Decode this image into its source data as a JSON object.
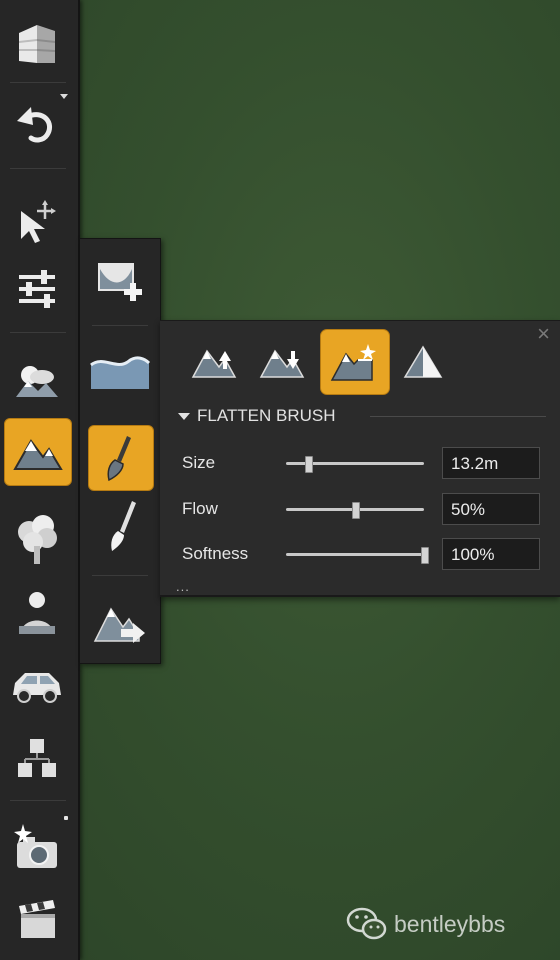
{
  "toolbar": {
    "items": [
      {
        "name": "building-icon"
      },
      {
        "name": "undo-icon"
      },
      {
        "name": "select-move-icon"
      },
      {
        "name": "sliders-icon"
      },
      {
        "name": "sky-icon"
      },
      {
        "name": "terrain-icon",
        "active": true
      },
      {
        "name": "tree-icon"
      },
      {
        "name": "person-icon"
      },
      {
        "name": "car-icon"
      },
      {
        "name": "cubes-icon"
      },
      {
        "name": "camera-icon"
      },
      {
        "name": "clapperboard-icon"
      }
    ]
  },
  "sub_palette": {
    "items": [
      {
        "name": "add-terrain-icon"
      },
      {
        "name": "water-icon"
      },
      {
        "name": "brush-icon",
        "active": true
      },
      {
        "name": "paint-brush-icon"
      },
      {
        "name": "terrain-export-icon"
      }
    ]
  },
  "panel": {
    "close_label": "×",
    "modes": [
      {
        "name": "raise-icon"
      },
      {
        "name": "lower-icon"
      },
      {
        "name": "flatten-icon",
        "active": true
      },
      {
        "name": "smooth-icon"
      }
    ],
    "section_title": "FLATTEN BRUSH",
    "params": [
      {
        "label": "Size",
        "value": "13.2m",
        "fraction": 0.16
      },
      {
        "label": "Flow",
        "value": "50%",
        "fraction": 0.5
      },
      {
        "label": "Softness",
        "value": "100%",
        "fraction": 1.0
      }
    ],
    "more_label": "..."
  },
  "watermark": {
    "text": "bentleybbs"
  },
  "colors": {
    "accent": "#e8a524",
    "panel": "#2b2b2b",
    "toolbar": "#262626",
    "background": "#3b5533"
  }
}
